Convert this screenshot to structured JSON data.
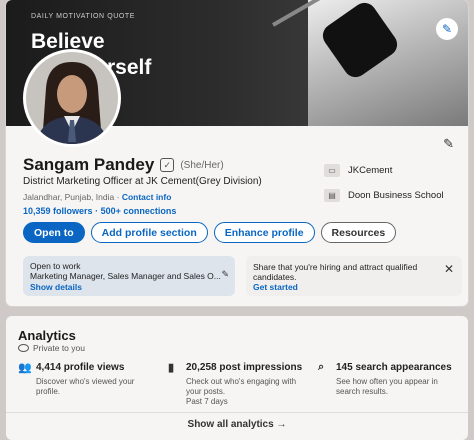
{
  "banner": {
    "label": "DAILY MOTIVATION QUOTE",
    "quote_line1": "Believe",
    "quote_line2": "rself"
  },
  "profile": {
    "name": "Sangam Pandey",
    "pronouns": "(She/Her)",
    "headline": "District Marketing Officer at JK Cement(Grey Division)",
    "location": "Jalandhar, Punjab, India",
    "contact_info": "Contact info",
    "followers": "10,359 followers",
    "connections": "500+ connections",
    "separator": "·"
  },
  "orgs": [
    {
      "name": "JKCement",
      "icon": "company-logo-icon"
    },
    {
      "name": "Doon Business School",
      "icon": "school-logo-icon"
    }
  ],
  "buttons": {
    "open_to": "Open to",
    "add_section": "Add profile section",
    "enhance": "Enhance profile",
    "resources": "Resources"
  },
  "open_to_work": {
    "title": "Open to work",
    "roles": "Marketing Manager, Sales Manager and Sales O...",
    "link": "Show details"
  },
  "hiring": {
    "line1": "Share that you're hiring and attract qualified",
    "line2": "candidates.",
    "link": "Get started"
  },
  "analytics": {
    "title": "Analytics",
    "private": "Private to you",
    "metrics": [
      {
        "title": "4,414 profile views",
        "desc1": "Discover who's viewed your",
        "desc2": "profile.",
        "desc3": "",
        "icon": "people-icon"
      },
      {
        "title": "20,258 post impressions",
        "desc1": "Check out who's engaging with",
        "desc2": "your posts.",
        "desc3": "Past 7 days",
        "icon": "bar-chart-icon"
      },
      {
        "title": "145 search appearances",
        "desc1": "See how often you appear in",
        "desc2": "search results.",
        "desc3": "",
        "icon": "search-icon"
      }
    ],
    "show_all": "Show all analytics →"
  }
}
